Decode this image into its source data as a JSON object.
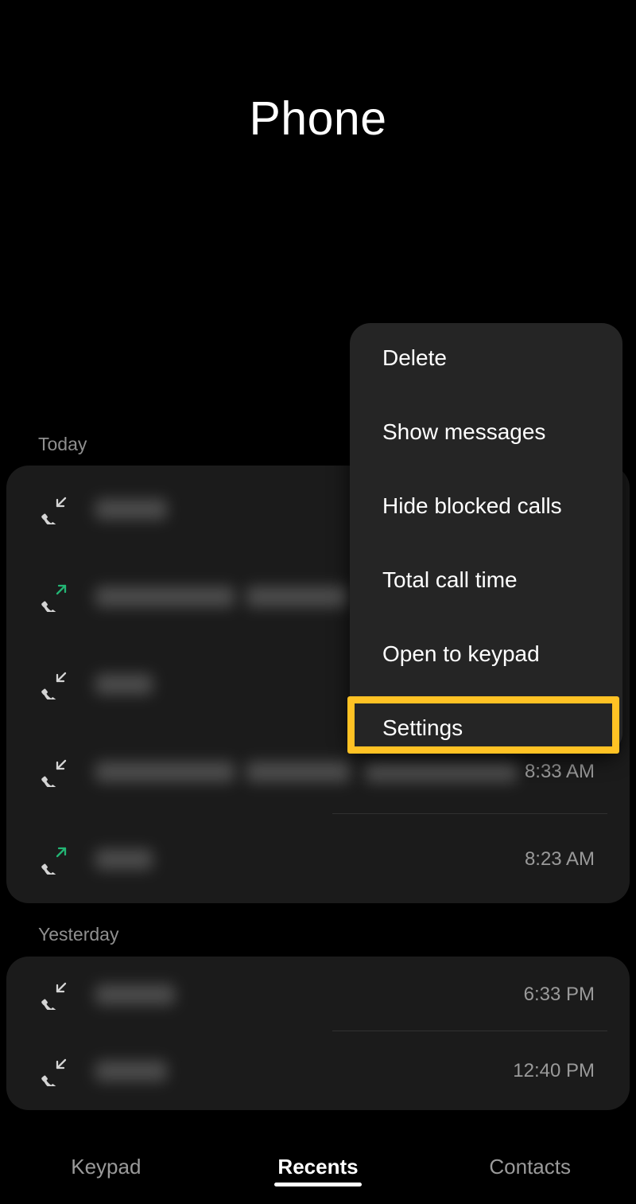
{
  "header": {
    "title": "Phone"
  },
  "sections": [
    {
      "label": "Today",
      "rows": [
        {
          "direction": "incoming",
          "time": "",
          "name_redacted": true,
          "bars": [
            [
              120,
              90
            ]
          ]
        },
        {
          "direction": "outgoing",
          "time": "",
          "name_redacted": true,
          "bars": [
            [
              120,
              175
            ],
            [
              310,
              130
            ],
            [
              460,
              190
            ]
          ]
        },
        {
          "direction": "incoming",
          "time": "",
          "name_redacted": true,
          "bars": [
            [
              120,
              72
            ]
          ]
        },
        {
          "direction": "incoming",
          "time": "8:33 AM",
          "name_redacted": true,
          "bars": [
            [
              120,
              175
            ],
            [
              310,
              130
            ],
            [
              460,
              190
            ]
          ]
        },
        {
          "direction": "outgoing",
          "time": "8:23 AM",
          "name_redacted": true,
          "bars": [
            [
              120,
              72
            ]
          ]
        }
      ]
    },
    {
      "label": "Yesterday",
      "rows": [
        {
          "direction": "incoming",
          "time": "6:33 PM",
          "name_redacted": true,
          "bars": [
            [
              120,
              100
            ]
          ]
        },
        {
          "direction": "incoming",
          "time": "12:40 PM",
          "name_redacted": true,
          "bars": [
            [
              120,
              90
            ]
          ]
        }
      ]
    }
  ],
  "overflow_menu": {
    "items": [
      {
        "label": "Delete"
      },
      {
        "label": "Show messages"
      },
      {
        "label": "Hide blocked calls"
      },
      {
        "label": "Total call time"
      },
      {
        "label": "Open to keypad"
      },
      {
        "label": "Settings"
      }
    ],
    "highlighted_item": "Settings",
    "highlight_color": "#FFC224"
  },
  "bottom_nav": {
    "tabs": [
      {
        "label": "Keypad",
        "active": false
      },
      {
        "label": "Recents",
        "active": true
      },
      {
        "label": "Contacts",
        "active": false
      }
    ]
  },
  "icons": {
    "incoming_call": "call-received-icon",
    "outgoing_call": "call-made-icon",
    "incoming_color": "#d4d4d4",
    "outgoing_color": "#23b574"
  }
}
